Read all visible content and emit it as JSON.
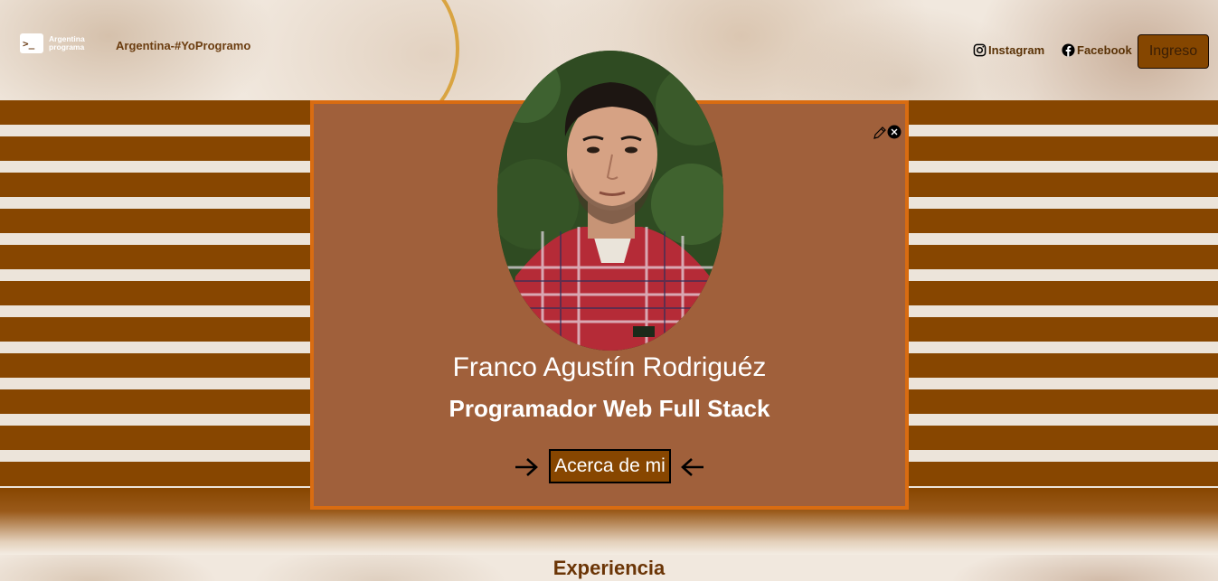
{
  "nav": {
    "logo_line1": "Argentina",
    "logo_line2": "programa",
    "brand": "Argentina-#YoProgramo",
    "instagram_label": "Instagram",
    "facebook_label": "Facebook",
    "login_label": "Ingreso"
  },
  "profile": {
    "name": "Franco Agustín Rodriguéz",
    "role": "Programador Web Full Stack",
    "about_label": "Acerca de mi"
  },
  "section": {
    "experience_title": "Experiencia"
  },
  "icons": {
    "instagram": "instagram-icon",
    "facebook": "facebook-icon",
    "edit": "pencil-icon",
    "close": "close-icon",
    "arrow_right": "arrow-right-icon",
    "arrow_left": "arrow-left-icon"
  },
  "colors": {
    "accent": "#874600",
    "card": "#a0603b",
    "card_border": "#d96c11"
  }
}
